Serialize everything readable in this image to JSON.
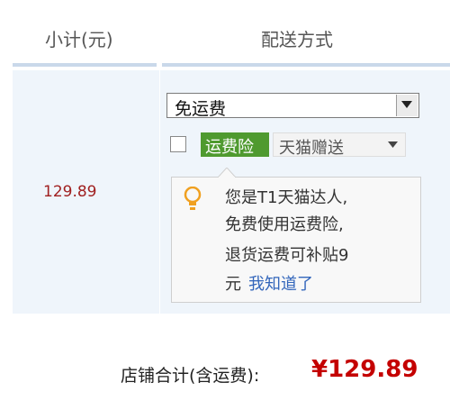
{
  "header": {
    "subtotal_title": "小计(元)",
    "delivery_title": "配送方式"
  },
  "item": {
    "subtotal": "129.89"
  },
  "delivery": {
    "selected": "免运费"
  },
  "insurance": {
    "checked": false,
    "badge": "运费险",
    "gift_label": "天猫赠送"
  },
  "tip": {
    "line1": "您是T1天猫达人,",
    "line2": "免费使用运费险,",
    "line3": "退货运费可补贴9",
    "line4": "元",
    "link": "我知道了"
  },
  "footer": {
    "total_label": "店铺合计(含运费):",
    "total_value": "¥129.89"
  },
  "colors": {
    "accent_red": "#c40000",
    "badge_green": "#4f9a2f",
    "link_blue": "#3366bb",
    "panel_blue": "#eff5fb"
  },
  "icons": {
    "select_arrow": "triangle-down-icon",
    "gift_arrow": "triangle-down-icon",
    "tip_icon": "lightbulb-icon"
  }
}
